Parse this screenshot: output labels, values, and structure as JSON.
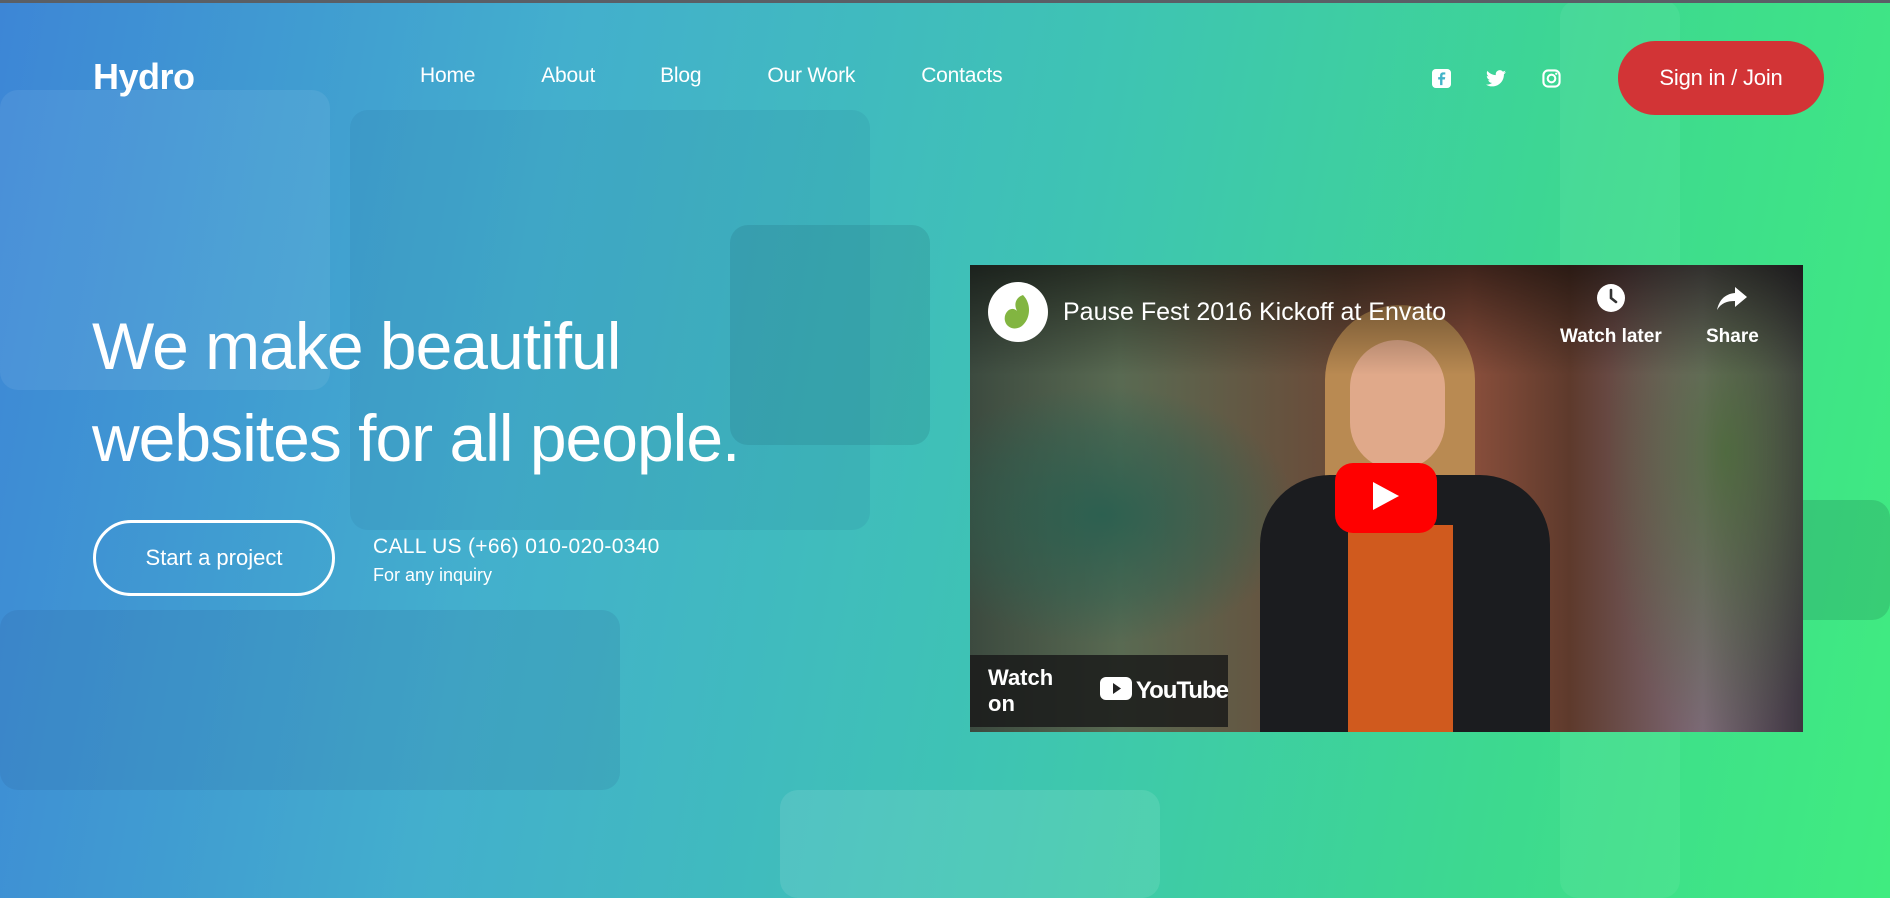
{
  "brand": {
    "name": "Hydro"
  },
  "nav": {
    "items": [
      {
        "label": "Home"
      },
      {
        "label": "About"
      },
      {
        "label": "Blog"
      },
      {
        "label": "Our Work"
      },
      {
        "label": "Contacts"
      }
    ]
  },
  "socials": [
    {
      "icon": "facebook-icon"
    },
    {
      "icon": "twitter-icon"
    },
    {
      "icon": "instagram-icon"
    }
  ],
  "header": {
    "signin_label": "Sign in / Join"
  },
  "hero": {
    "title_line1": "We make beautiful",
    "title_line2": "websites for all people.",
    "cta_label": "Start a project",
    "call_title": "CALL US (+66) 010-020-0340",
    "call_subtitle": "For any inquiry"
  },
  "video": {
    "title": "Pause Fest 2016 Kickoff at Envato",
    "watch_later_label": "Watch later",
    "share_label": "Share",
    "watch_on_label": "Watch on",
    "platform_label": "YouTube"
  },
  "colors": {
    "accent_red": "#d23436",
    "youtube_red": "#ff0000",
    "gradient_start": "#3d86d6",
    "gradient_end": "#40ec80"
  }
}
